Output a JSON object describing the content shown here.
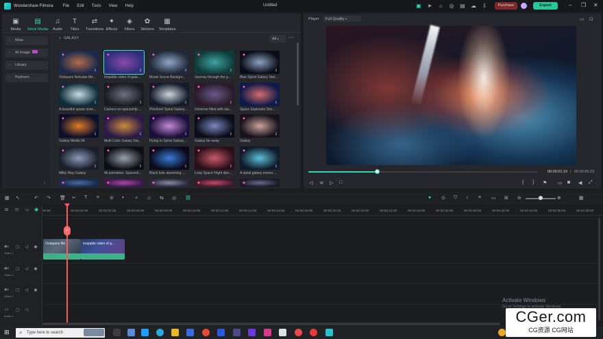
{
  "titlebar": {
    "app_name": "Wondershare Filmora",
    "menu": [
      "File",
      "Edit",
      "Tools",
      "View",
      "Help"
    ],
    "doc_title": "Untitled",
    "purchase": "Purchase",
    "export": "Export"
  },
  "toolbar": {
    "items": [
      {
        "label": "Media",
        "icon": "media-icon"
      },
      {
        "label": "Stock Media",
        "icon": "stock-media-icon"
      },
      {
        "label": "Audio",
        "icon": "audio-icon"
      },
      {
        "label": "Titles",
        "icon": "titles-icon"
      },
      {
        "label": "Transitions",
        "icon": "transitions-icon"
      },
      {
        "label": "Effects",
        "icon": "effects-icon"
      },
      {
        "label": "Filters",
        "icon": "filters-icon"
      },
      {
        "label": "Stickers",
        "icon": "stickers-icon"
      },
      {
        "label": "Templates",
        "icon": "templates-icon"
      }
    ],
    "active": "Stock Media"
  },
  "sidebar": {
    "items": [
      "Mine",
      "AI Image",
      "Library",
      "Partners"
    ]
  },
  "library": {
    "search_value": "GALAXY",
    "filter": "All",
    "thumbs": [
      {
        "label": "Outspace Nebulae Me...",
        "c1": "#1b2a4a",
        "c2": "#b56b4c"
      },
      {
        "label": "loopable video of gala...",
        "c1": "#2a2f7a",
        "c2": "#8e4aa8"
      },
      {
        "label": "Movie Scene Backgro...",
        "c1": "#202a3a",
        "c2": "#8fa6c8"
      },
      {
        "label": "Journey through the g...",
        "c1": "#0f3b3b",
        "c2": "#3fa3a0"
      },
      {
        "label": "Blue Spiral Galaxy Star...",
        "c1": "#0a0c18",
        "c2": "#8da0c0"
      },
      {
        "label": "A beautiful space scen...",
        "c1": "#0f2c38",
        "c2": "#c6dfe6"
      },
      {
        "label": "Camera on spaceship ...",
        "c1": "#1a1a22",
        "c2": "#6d7280"
      },
      {
        "label": "Pinwheel Spiral Galaxy...",
        "c1": "#141a2a",
        "c2": "#d0d4dc"
      },
      {
        "label": "Universe filled with sta...",
        "c1": "#2a1a2a",
        "c2": "#6a5a8a"
      },
      {
        "label": "Space Explosion Stor...",
        "c1": "#0d1a4a",
        "c2": "#d66b6b"
      },
      {
        "label": "Galaxy Media 04",
        "c1": "#0a0f2a",
        "c2": "#e07a2a"
      },
      {
        "label": "Multi Color Galaxy Sta...",
        "c1": "#2a1a4a",
        "c2": "#c98a3a"
      },
      {
        "label": "Flying to Spiral Galaxy...",
        "c1": "#1a0f3a",
        "c2": "#c58ad8"
      },
      {
        "label": "Galaxy far away",
        "c1": "#0a0c18",
        "c2": "#7a86c0"
      },
      {
        "label": "Galaxy",
        "c1": "#18121c",
        "c2": "#c9a39a"
      },
      {
        "label": "Milky Way Galaxy",
        "c1": "#1a1e2a",
        "c2": "#8a9ab8"
      },
      {
        "label": "4k animation. Spacesh...",
        "c1": "#0c0e14",
        "c2": "#9aa0ab"
      },
      {
        "label": "Black hole absorbing ...",
        "c1": "#0a0a1a",
        "c2": "#3a7ad8"
      },
      {
        "label": "Loop Space Flight dee...",
        "c1": "#2a0f1a",
        "c2": "#c85a6a"
      },
      {
        "label": "A spiral galaxy moves ...",
        "c1": "#0f1a2a",
        "c2": "#5ac0d8"
      },
      {
        "label": "",
        "c1": "#1a2a4a",
        "c2": "#4a6aa8"
      },
      {
        "label": "",
        "c1": "#3a1a4a",
        "c2": "#a84aa8"
      },
      {
        "label": "",
        "c1": "#2a2a3a",
        "c2": "#8a8aa8"
      },
      {
        "label": "",
        "c1": "#3a1a2a",
        "c2": "#c84a6a"
      },
      {
        "label": "",
        "c1": "#1a1a2a",
        "c2": "#6a6a8a"
      }
    ]
  },
  "player": {
    "label": "Player",
    "quality": "Full Quality",
    "current_time": "00:00:01:19",
    "total_time": "00:00:05:23",
    "progress": 0.3
  },
  "timeline": {
    "ticks": [
      "00:00",
      "00:00:02:00",
      "00:00:04:00",
      "00:00:06:00",
      "00:00:08:00",
      "00:00:10:00",
      "00:00:12:00",
      "00:00:14:00",
      "00:00:16:00",
      "00:00:18:00",
      "00:00:20:00",
      "00:00:22:00",
      "00:00:24:00",
      "00:00:26:00",
      "00:00:28:00",
      "00:00:30:00",
      "00:00:32:00",
      "00:00:34:00",
      "00:00:36:00",
      "00:00:38:00"
    ],
    "tracks": [
      {
        "num": "1",
        "name": "Video 1"
      },
      {
        "num": "3",
        "name": "Video 3"
      },
      {
        "num": "1",
        "name": "Video 1"
      },
      {
        "num": "1",
        "name": "Audio 1"
      }
    ],
    "clips": [
      {
        "label": "Outspace Ne..."
      },
      {
        "label": "loopable video of g..."
      }
    ],
    "playhead_icon": "playhead-handle-icon"
  },
  "activation": {
    "line1": "Activate Windows",
    "line2": "Go to Settings to activate Windows."
  },
  "taskbar": {
    "search_placeholder": "Type here to search"
  },
  "watermark": {
    "line1": "CGer.com",
    "line2": "CG资源  CG网站"
  }
}
